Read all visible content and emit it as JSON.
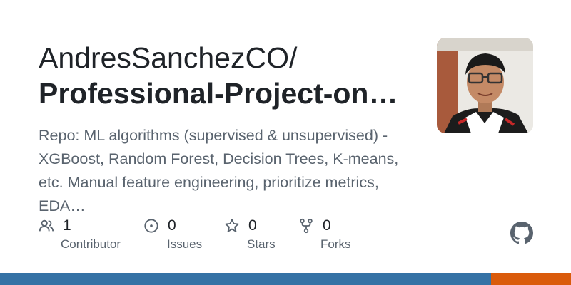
{
  "header": {
    "owner": "AndresSanchezCO/",
    "repo": "Professional-Project-on…"
  },
  "description": "Repo: ML algorithms (supervised & unsupervised) - XGBoost, Random Forest, Decision Trees, K-means, etc. Manual feature engineering, prioritize metrics, EDA…",
  "stats": [
    {
      "icon": "people-icon",
      "value": "1",
      "label": "Contributor"
    },
    {
      "icon": "issue-icon",
      "value": "0",
      "label": "Issues"
    },
    {
      "icon": "star-icon",
      "value": "0",
      "label": "Stars"
    },
    {
      "icon": "fork-icon",
      "value": "0",
      "label": "Forks"
    }
  ],
  "language_bar": [
    {
      "color": "#3572a5",
      "fraction": 0.86
    },
    {
      "color": "#da5b0b",
      "fraction": 0.14
    }
  ],
  "colors": {
    "text": "#1f2328",
    "muted": "#59636e"
  }
}
